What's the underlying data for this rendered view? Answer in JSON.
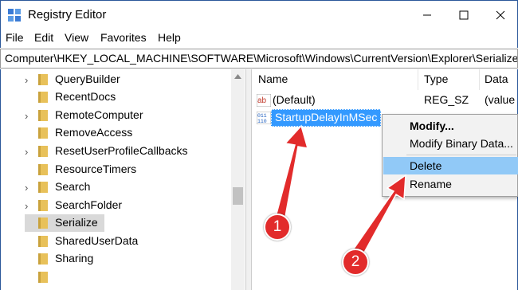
{
  "window": {
    "title": "Registry Editor",
    "minimize_glyph": "—",
    "maximize_glyph": "☐",
    "close_glyph": "✕"
  },
  "menu": {
    "items": [
      "File",
      "Edit",
      "View",
      "Favorites",
      "Help"
    ]
  },
  "address": {
    "path": "Computer\\HKEY_LOCAL_MACHINE\\SOFTWARE\\Microsoft\\Windows\\CurrentVersion\\Explorer\\Serialize"
  },
  "tree": {
    "items": [
      {
        "label": "QueryBuilder",
        "expandable": true
      },
      {
        "label": "RecentDocs",
        "expandable": false
      },
      {
        "label": "RemoteComputer",
        "expandable": true
      },
      {
        "label": "RemoveAccess",
        "expandable": false
      },
      {
        "label": "ResetUserProfileCallbacks",
        "expandable": true
      },
      {
        "label": "ResourceTimers",
        "expandable": false
      },
      {
        "label": "Search",
        "expandable": true
      },
      {
        "label": "SearchFolder",
        "expandable": true
      },
      {
        "label": "Serialize",
        "expandable": false,
        "selected": true
      },
      {
        "label": "SharedUserData",
        "expandable": false
      },
      {
        "label": "Sharing",
        "expandable": false
      }
    ]
  },
  "list": {
    "headers": {
      "name": "Name",
      "type": "Type",
      "data": "Data"
    },
    "rows": [
      {
        "name": "(Default)",
        "type": "REG_SZ",
        "data": "(value",
        "icon": "string-value-icon"
      },
      {
        "name": "StartupDelayInMSec",
        "type": "",
        "data": "",
        "icon": "binary-value-icon",
        "selected": true
      }
    ]
  },
  "context_menu": {
    "items": [
      {
        "label": "Modify...",
        "bold": true
      },
      {
        "label": "Modify Binary Data..."
      },
      {
        "label": "Delete",
        "hover": true
      },
      {
        "label": "Rename"
      }
    ]
  },
  "annotations": {
    "step1": "1",
    "step2": "2",
    "color": "#e22b2b"
  },
  "colors": {
    "selection": "#3399ff",
    "menu_hover": "#91c9f7",
    "folder": "#e8c15a"
  }
}
